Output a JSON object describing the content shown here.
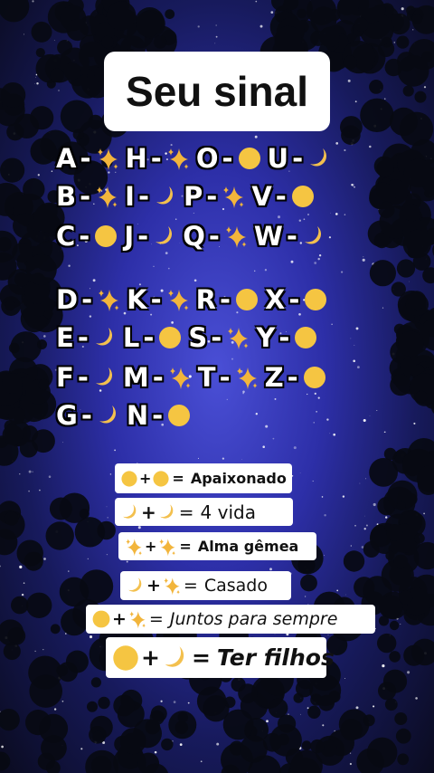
{
  "title": "Seu sinal",
  "colors": {
    "sun": "#f5c542",
    "moon": "#f3c04e",
    "sparkle": "#f2b53c"
  },
  "alphabet_rows": [
    [
      {
        "letter": "A",
        "symbol": "sparkle"
      },
      {
        "letter": "H",
        "symbol": "sparkle"
      },
      {
        "letter": "O",
        "symbol": "circle"
      },
      {
        "letter": "U",
        "symbol": "moon"
      }
    ],
    [
      {
        "letter": "B",
        "symbol": "sparkle"
      },
      {
        "letter": "I",
        "symbol": "moon"
      },
      {
        "letter": "P",
        "symbol": "sparkle"
      },
      {
        "letter": "V",
        "symbol": "circle"
      }
    ],
    [
      {
        "letter": "C",
        "symbol": "circle"
      },
      {
        "letter": "J",
        "symbol": "moon"
      },
      {
        "letter": "Q",
        "symbol": "sparkle"
      },
      {
        "letter": "W",
        "symbol": "moon"
      }
    ],
    [
      {
        "letter": "D",
        "symbol": "sparkle"
      },
      {
        "letter": "K",
        "symbol": "sparkle"
      },
      {
        "letter": "R",
        "symbol": "circle"
      },
      {
        "letter": "X",
        "symbol": "circle"
      }
    ],
    [
      {
        "letter": "E",
        "symbol": "moon"
      },
      {
        "letter": "L",
        "symbol": "circle"
      },
      {
        "letter": "S",
        "symbol": "sparkle"
      },
      {
        "letter": "Y",
        "symbol": "circle"
      }
    ],
    [
      {
        "letter": "F",
        "symbol": "moon"
      },
      {
        "letter": "M",
        "symbol": "sparkle"
      },
      {
        "letter": "T",
        "symbol": "sparkle"
      },
      {
        "letter": "Z",
        "symbol": "circle"
      }
    ],
    [
      {
        "letter": "G",
        "symbol": "moon"
      },
      {
        "letter": "N",
        "symbol": "circle"
      }
    ]
  ],
  "separator": "-",
  "combinations": [
    {
      "a": "circle",
      "b": "circle",
      "text": "Apaixonado"
    },
    {
      "a": "moon",
      "b": "moon",
      "text": "4 vida"
    },
    {
      "a": "sparkle",
      "b": "sparkle",
      "text": "Alma gêmea"
    },
    {
      "a": "moon",
      "b": "sparkle",
      "text": "Casado"
    },
    {
      "a": "circle",
      "b": "sparkle",
      "text": "Juntos para sempre"
    },
    {
      "a": "circle",
      "b": "moon",
      "text": "Ter filhos"
    }
  ],
  "plus": "+",
  "equals": "="
}
